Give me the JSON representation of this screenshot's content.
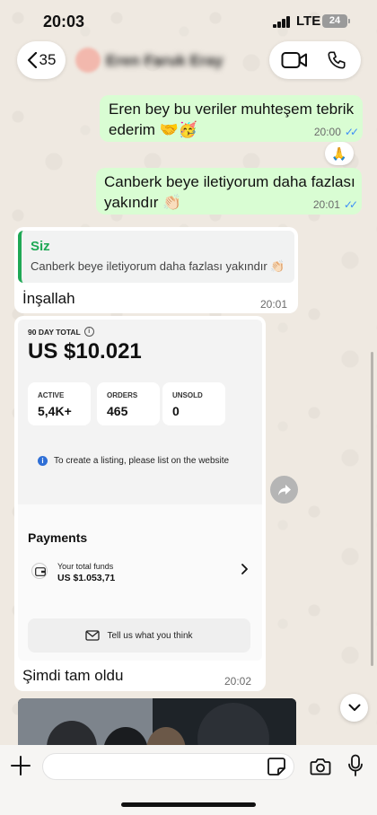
{
  "status": {
    "time": "20:03",
    "network": "LTE",
    "battery": "24"
  },
  "header": {
    "back_count": "35",
    "contact_name": "Eren Faruk Eray"
  },
  "messages": [
    {
      "text": "Eren bey bu veriler muhteşem tebrik ederim 🤝🥳",
      "time": "20:00",
      "reaction": "🙏"
    },
    {
      "text": "Canberk beye iletiyorum daha fazlası yakındır 👏🏻",
      "time": "20:01"
    }
  ],
  "reply": {
    "quote_author": "Siz",
    "quote_text": "Canberk beye iletiyorum daha fazlası yakındır 👏🏻",
    "text": "İnşallah",
    "time": "20:01"
  },
  "card": {
    "total_label": "90 DAY TOTAL",
    "total_value": "US $10.021",
    "stats": [
      {
        "label": "ACTIVE",
        "value": "5,4K+"
      },
      {
        "label": "ORDERS",
        "value": "465"
      },
      {
        "label": "UNSOLD",
        "value": "0"
      }
    ],
    "listing_note": "To create a listing, please list on the website",
    "payments_title": "Payments",
    "funds_label": "Your total funds",
    "funds_value": "US $1.053,71",
    "feedback_label": "Tell us what you think",
    "caption": "Şimdi tam oldu",
    "time": "20:02"
  },
  "composer": {
    "placeholder": ""
  },
  "colors": {
    "outgoing": "#d9fdd3",
    "incoming": "#ffffff",
    "accent": "#1fa855",
    "ticks": "#3d8ef7"
  }
}
